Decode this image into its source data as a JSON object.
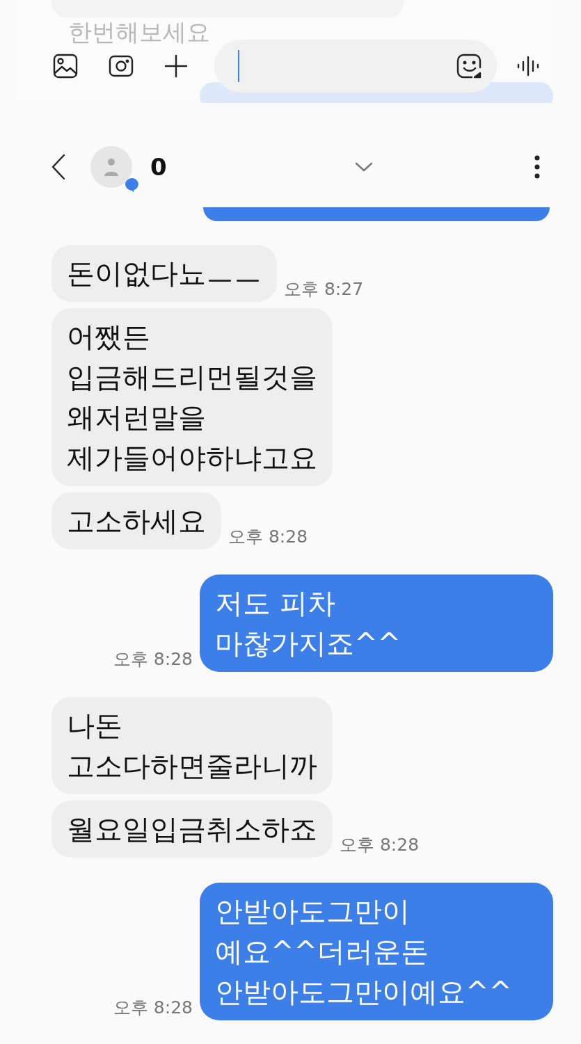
{
  "previous_screen": {
    "faded_message": "한번해보세요"
  },
  "header": {
    "contact_name": "0"
  },
  "messages": [
    {
      "kind": "incoming",
      "text": "돈이없다뇨ㅡㅡ",
      "time": "오후 8:27"
    },
    {
      "kind": "incoming",
      "text": "어쨌든\n입금해드리먼될것을\n왜저런말을\n제가들어야하냐고요"
    },
    {
      "kind": "incoming",
      "text": "고소하세요",
      "time": "오후 8:28"
    },
    {
      "kind": "outgoing",
      "text": "저도 피차\n마찮가지죠^^",
      "time": "오후 8:28"
    },
    {
      "kind": "incoming",
      "text": "나돈\n고소다하면줄라니까"
    },
    {
      "kind": "incoming",
      "text": "월요일입금취소하죠",
      "time": "오후 8:28"
    },
    {
      "kind": "outgoing",
      "text": "안받아도그만이\n예요^^더러운돈\n안받아도그만이예요^^",
      "time": "오후 8:28"
    }
  ]
}
